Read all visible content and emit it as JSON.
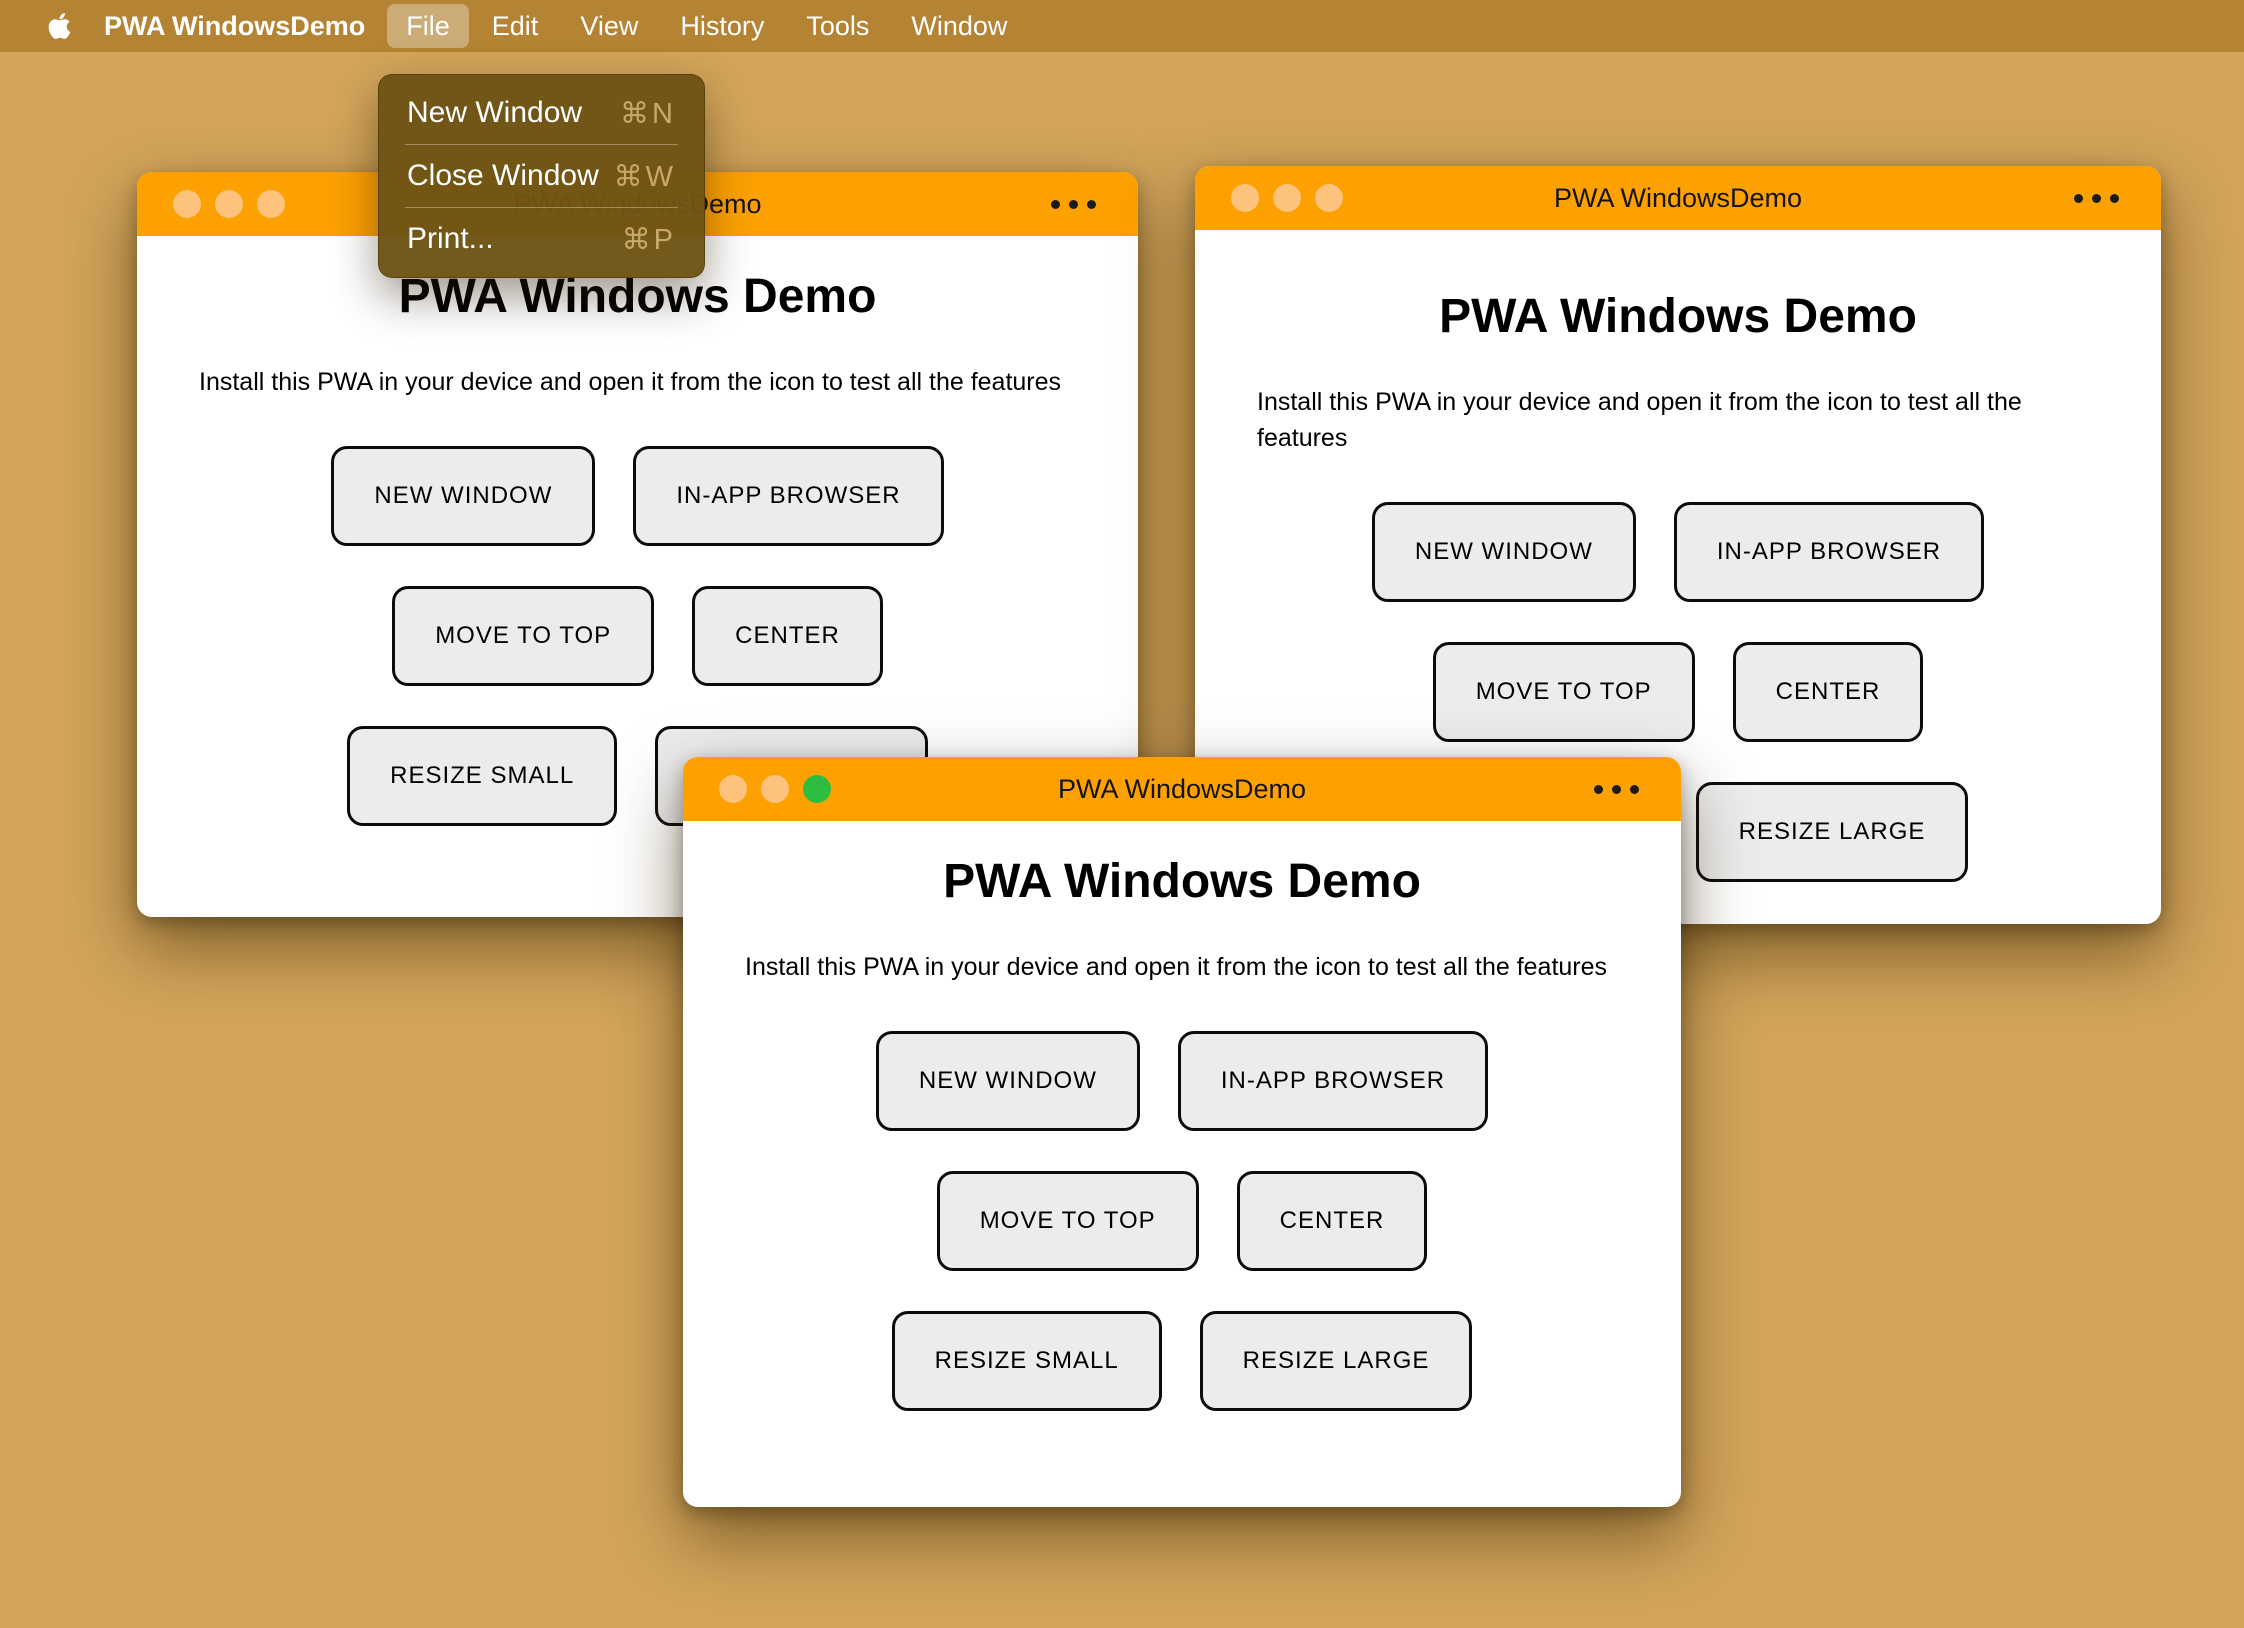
{
  "menu_bar": {
    "app_name": "PWA WindowsDemo",
    "menus": [
      "File",
      "Edit",
      "View",
      "History",
      "Tools",
      "Window"
    ],
    "active_menu": "File"
  },
  "file_menu": {
    "items": [
      {
        "label": "New Window",
        "shortcut": "⌘N"
      },
      {
        "label": "Close Window",
        "shortcut": "⌘W"
      },
      {
        "label": "Print...",
        "shortcut": "⌘P"
      }
    ]
  },
  "window_content": {
    "title": "PWA WindowsDemo",
    "heading": "PWA Windows Demo",
    "description": "Install this PWA in your device and open it from the icon to test all the features",
    "buttons": [
      "NEW WINDOW",
      "IN-APP BROWSER",
      "MOVE TO TOP",
      "CENTER",
      "RESIZE SMALL",
      "RESIZE LARGE"
    ]
  },
  "windows": [
    {
      "id": "left",
      "active": false
    },
    {
      "id": "right",
      "active": false
    },
    {
      "id": "front",
      "active": true
    }
  ],
  "icons": {
    "apple": "apple-logo",
    "window_overflow": "ellipsis",
    "traffic_lights": [
      "close",
      "minimize",
      "zoom"
    ]
  },
  "colors": {
    "desktop": "#d2a55a",
    "menu_bar": "#b48434",
    "menu_panel": "#6e5415",
    "titlebar": "#fda102",
    "traffic_inactive": "#fdc37c",
    "traffic_green": "#2ebd41",
    "window_bg": "#ffffff",
    "button_bg": "#ececec",
    "button_border": "#0c0c0c"
  }
}
